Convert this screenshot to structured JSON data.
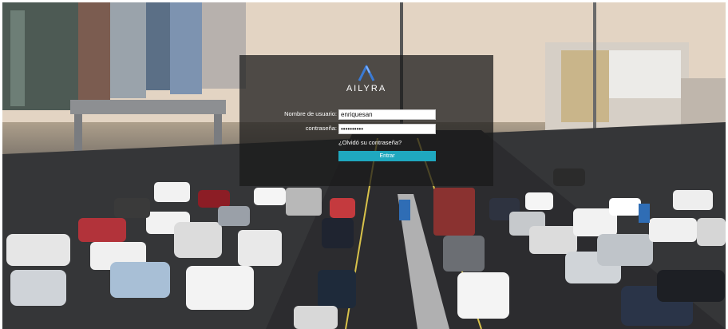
{
  "brand": {
    "name": "AILYRA",
    "accent": "#3a7bd5",
    "button_color": "#1fa8bf"
  },
  "background": {
    "description_icon": "traffic-photo"
  },
  "login": {
    "username_label": "Nombre de usuario:",
    "username_value": "enriquesan",
    "password_label": "contraseña:",
    "password_value": "enriquesan",
    "forgot_link": "¿Olvidó su contraseña?",
    "submit_label": "Entrar"
  }
}
